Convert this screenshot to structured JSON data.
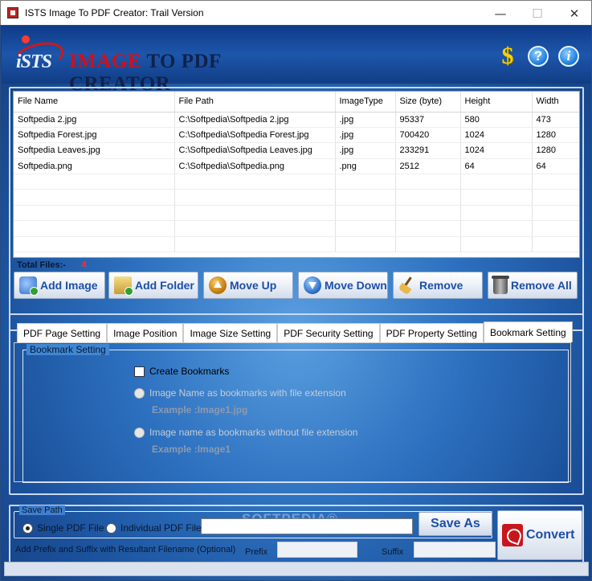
{
  "window": {
    "title": "ISTS Image To PDF Creator: Trail Version",
    "controls": {
      "minimize": "—",
      "maximize": "☐",
      "close": "✕"
    }
  },
  "header": {
    "logo_prefix": "iSTS",
    "logo_word1": "IMAGE",
    "logo_word2": "TO PDF CREATOR",
    "icons": [
      "dollar-icon",
      "help-icon",
      "info-icon"
    ],
    "dollar_glyph": "$",
    "help_glyph": "?",
    "info_glyph": "i"
  },
  "file_table": {
    "columns": [
      "File Name",
      "File Path",
      "ImageType",
      "Size (byte)",
      "Height",
      "Width"
    ],
    "rows": [
      [
        "Softpedia 2.jpg",
        "C:\\Softpedia\\Softpedia 2.jpg",
        ".jpg",
        "95337",
        "580",
        "473"
      ],
      [
        "Softpedia Forest.jpg",
        "C:\\Softpedia\\Softpedia Forest.jpg",
        ".jpg",
        "700420",
        "1024",
        "1280"
      ],
      [
        "Softpedia Leaves.jpg",
        "C:\\Softpedia\\Softpedia Leaves.jpg",
        ".jpg",
        "233291",
        "1024",
        "1280"
      ],
      [
        "Softpedia.png",
        "C:\\Softpedia\\Softpedia.png",
        ".png",
        "2512",
        "64",
        "64"
      ]
    ],
    "total_label": "Total Files:-",
    "total_count": "4"
  },
  "actions": {
    "add_image": "Add Image",
    "add_folder": "Add Folder",
    "move_up": "Move Up",
    "move_down": "Move Down",
    "remove": "Remove",
    "remove_all": "Remove All"
  },
  "settings": {
    "tabs": [
      "PDF Page Setting",
      "Image Position",
      "Image Size Setting",
      "PDF Security Setting",
      "PDF Property Setting",
      "Bookmark Setting"
    ],
    "active_tab": "Bookmark Setting",
    "group_title": "Bookmark Setting",
    "create_bookmarks": "Create Bookmarks",
    "option_with_ext": "Image Name as bookmarks with file extension",
    "example_with_ext": "Example :Image1.jpg",
    "option_without_ext": "Image name as bookmarks without file extension",
    "example_without_ext": "Example :Image1"
  },
  "save": {
    "group_title": "Save Path",
    "single_pdf": "Single PDF File",
    "individual_pdf": "Individual PDF File",
    "path_value": "",
    "save_as": "Save As",
    "convert": "Convert",
    "prefix_note": "Add Prefix and Suffix with Resultant Filename (Optional)",
    "prefix_label": "Prefix",
    "suffix_label": "Suffix",
    "prefix_value": "",
    "suffix_value": ""
  },
  "watermark": "SOFTPEDIA®",
  "colors": {
    "accent_blue": "#1d4fa8",
    "background_blue": "#2d71c0",
    "logo_red": "#d0101a",
    "count_red": "#ff2a2a"
  }
}
